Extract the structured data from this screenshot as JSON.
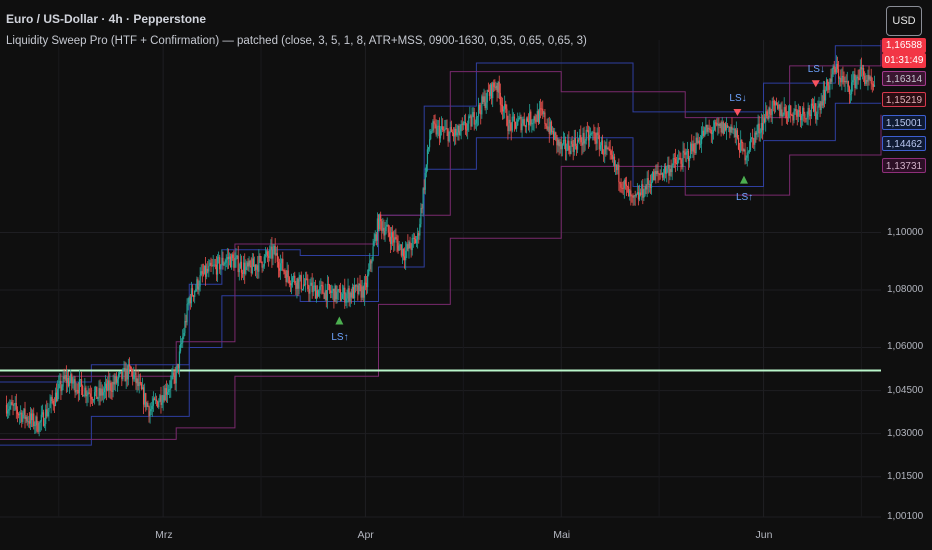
{
  "header": {
    "title": "Euro / US-Dollar · 4h · Pepperstone",
    "indicator": "Liquidity Sweep Pro (HTF + Confirmation) — patched (close, 3, 5, 1, 8, ATR+MSS, 0900-1630, 0,35, 0,65, 0,65, 3)"
  },
  "currency_button": "USD",
  "price_axis": {
    "ticks": [
      "1,10000",
      "1,08000",
      "1,06000",
      "1,04500",
      "1,03000",
      "1,01500",
      "1,00100"
    ]
  },
  "time_axis": {
    "ticks": [
      "Mrz",
      "Apr",
      "Mai",
      "Jun"
    ]
  },
  "badges": [
    {
      "text": "1,16588",
      "bg": "#f23645",
      "fg": "#ffffff"
    },
    {
      "text": "01:31:49",
      "bg": "#f23645",
      "fg": "#ffffff"
    },
    {
      "text": "1,16314",
      "bg": "#3a1530",
      "fg": "#c8c8d0",
      "border": "#a23b8c"
    },
    {
      "text": "1,15219",
      "bg": "#2a0d12",
      "fg": "#e0b0b8",
      "border": "#d5394d"
    },
    {
      "text": "1,15001",
      "bg": "#0f1a33",
      "fg": "#b8c6f0",
      "border": "#3d5fd1"
    },
    {
      "text": "1,14462",
      "bg": "#0f1a33",
      "fg": "#b8c6f0",
      "border": "#3d5fd1"
    },
    {
      "text": "1,13731",
      "bg": "#2c0f26",
      "fg": "#d0b0c8",
      "border": "#8e2f7a"
    }
  ],
  "signals": [
    {
      "label": "LS↓",
      "direction": "bearish",
      "date": "2025-05-28"
    },
    {
      "label": "LS↓",
      "direction": "bearish",
      "date": "2025-06-09"
    },
    {
      "label": "LS↑",
      "direction": "bullish",
      "date": "2025-03-28"
    },
    {
      "label": "LS↑",
      "direction": "bullish",
      "date": "2025-05-29"
    }
  ],
  "colors": {
    "up": "#26a69a",
    "down": "#ef5350",
    "bull_signal": "#4caf50",
    "bear_signal": "#f7525f",
    "hline": "#b9f6ca",
    "band_blue": "#2f3fa0",
    "band_purple": "#7a2a6e"
  },
  "chart_data": {
    "type": "candlestick",
    "symbol": "Euro / US-Dollar",
    "interval": "4h",
    "x_range": [
      "2025-02-04",
      "2025-06-19"
    ],
    "ylim": [
      1.001,
      1.167
    ],
    "horizontal_line": 1.052,
    "close_path": [
      [
        "2025-02-05",
        1.04
      ],
      [
        "2025-02-10",
        1.033
      ],
      [
        "2025-02-14",
        1.049
      ],
      [
        "2025-02-19",
        1.043
      ],
      [
        "2025-02-24",
        1.052
      ],
      [
        "2025-02-27",
        1.038
      ],
      [
        "2025-03-03",
        1.05
      ],
      [
        "2025-03-05",
        1.077
      ],
      [
        "2025-03-07",
        1.085
      ],
      [
        "2025-03-11",
        1.091
      ],
      [
        "2025-03-14",
        1.087
      ],
      [
        "2025-03-18",
        1.093
      ],
      [
        "2025-03-20",
        1.085
      ],
      [
        "2025-03-24",
        1.08
      ],
      [
        "2025-03-27",
        1.079
      ],
      [
        "2025-03-28",
        1.078
      ],
      [
        "2025-04-01",
        1.08
      ],
      [
        "2025-04-03",
        1.104
      ],
      [
        "2025-04-07",
        1.093
      ],
      [
        "2025-04-09",
        1.098
      ],
      [
        "2025-04-11",
        1.136
      ],
      [
        "2025-04-15",
        1.134
      ],
      [
        "2025-04-17",
        1.138
      ],
      [
        "2025-04-21",
        1.152
      ],
      [
        "2025-04-23",
        1.137
      ],
      [
        "2025-04-28",
        1.141
      ],
      [
        "2025-05-01",
        1.129
      ],
      [
        "2025-05-06",
        1.134
      ],
      [
        "2025-05-09",
        1.124
      ],
      [
        "2025-05-12",
        1.11
      ],
      [
        "2025-05-15",
        1.119
      ],
      [
        "2025-05-20",
        1.126
      ],
      [
        "2025-05-23",
        1.135
      ],
      [
        "2025-05-27",
        1.137
      ],
      [
        "2025-05-29",
        1.127
      ],
      [
        "2025-06-02",
        1.143
      ],
      [
        "2025-06-05",
        1.142
      ],
      [
        "2025-06-09",
        1.142
      ],
      [
        "2025-06-12",
        1.157
      ],
      [
        "2025-06-14",
        1.15
      ],
      [
        "2025-06-16",
        1.156
      ],
      [
        "2025-06-18",
        1.149
      ]
    ],
    "blue_band_upper": [
      [
        "2025-02-04",
        1.048
      ],
      [
        "2025-02-18",
        1.054
      ],
      [
        "2025-03-05",
        1.082
      ],
      [
        "2025-03-10",
        1.094
      ],
      [
        "2025-03-22",
        1.092
      ],
      [
        "2025-04-03",
        1.106
      ],
      [
        "2025-04-10",
        1.144
      ],
      [
        "2025-04-18",
        1.159
      ],
      [
        "2025-05-12",
        1.142
      ],
      [
        "2025-06-01",
        1.152
      ],
      [
        "2025-06-12",
        1.165
      ]
    ],
    "blue_band_lower": [
      [
        "2025-02-04",
        1.026
      ],
      [
        "2025-02-18",
        1.036
      ],
      [
        "2025-03-05",
        1.06
      ],
      [
        "2025-03-10",
        1.078
      ],
      [
        "2025-03-22",
        1.076
      ],
      [
        "2025-04-03",
        1.088
      ],
      [
        "2025-04-10",
        1.122
      ],
      [
        "2025-04-18",
        1.133
      ],
      [
        "2025-05-12",
        1.116
      ],
      [
        "2025-06-01",
        1.132
      ],
      [
        "2025-06-12",
        1.145
      ]
    ],
    "purple_band_upper": [
      [
        "2025-02-04",
        1.05
      ],
      [
        "2025-03-03",
        1.062
      ],
      [
        "2025-03-12",
        1.096
      ],
      [
        "2025-04-03",
        1.106
      ],
      [
        "2025-04-14",
        1.156
      ],
      [
        "2025-05-01",
        1.149
      ],
      [
        "2025-05-20",
        1.14
      ],
      [
        "2025-06-05",
        1.158
      ],
      [
        "2025-06-19",
        1.167
      ]
    ],
    "purple_band_lower": [
      [
        "2025-02-04",
        1.028
      ],
      [
        "2025-03-03",
        1.032
      ],
      [
        "2025-03-12",
        1.05
      ],
      [
        "2025-04-03",
        1.075
      ],
      [
        "2025-04-14",
        1.098
      ],
      [
        "2025-05-01",
        1.123
      ],
      [
        "2025-05-20",
        1.113
      ],
      [
        "2025-06-05",
        1.127
      ],
      [
        "2025-06-19",
        1.141
      ]
    ]
  }
}
